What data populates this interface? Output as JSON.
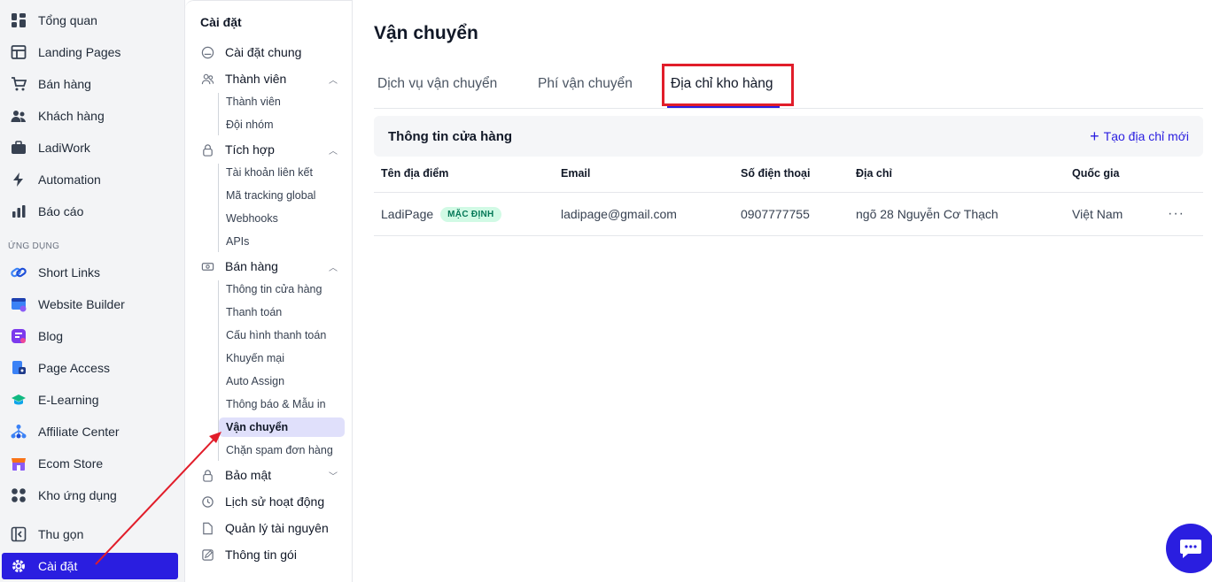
{
  "sidebar": {
    "items": [
      {
        "label": "Tổng quan",
        "icon": "dashboard-icon"
      },
      {
        "label": "Landing Pages",
        "icon": "layout-icon"
      },
      {
        "label": "Bán hàng",
        "icon": "cart-icon"
      },
      {
        "label": "Khách hàng",
        "icon": "users-icon"
      },
      {
        "label": "LadiWork",
        "icon": "briefcase-icon"
      },
      {
        "label": "Automation",
        "icon": "bolt-icon"
      },
      {
        "label": "Báo cáo",
        "icon": "bar-chart-icon"
      }
    ],
    "section_label": "ỨNG DỤNG",
    "apps": [
      {
        "label": "Short Links",
        "icon": "link-icon",
        "color": "#3b82f6"
      },
      {
        "label": "Website Builder",
        "icon": "website-icon",
        "color": "#6366f1"
      },
      {
        "label": "Blog",
        "icon": "blog-icon",
        "color": "#8b5cf6"
      },
      {
        "label": "Page Access",
        "icon": "page-access-icon",
        "color": "#2563eb"
      },
      {
        "label": "E-Learning",
        "icon": "elearning-icon",
        "color": "#10b981"
      },
      {
        "label": "Affiliate Center",
        "icon": "affiliate-icon",
        "color": "#3b82f6"
      },
      {
        "label": "Ecom Store",
        "icon": "store-icon",
        "color": "#f97316"
      },
      {
        "label": "Kho ứng dụng",
        "icon": "apps-icon",
        "color": "#374151"
      }
    ],
    "collapse_label": "Thu gọn",
    "settings_label": "Cài đặt"
  },
  "settings_nav": {
    "title": "Cài đặt",
    "general": "Cài đặt chung",
    "members": {
      "label": "Thành viên",
      "items": [
        "Thành viên",
        "Đội nhóm"
      ]
    },
    "integration": {
      "label": "Tích hợp",
      "items": [
        "Tài khoản liên kết",
        "Mã tracking global",
        "Webhooks",
        "APIs"
      ]
    },
    "sales": {
      "label": "Bán hàng",
      "items": [
        "Thông tin cửa hàng",
        "Thanh toán",
        "Cấu hình thanh toán",
        "Khuyến mại",
        "Auto Assign",
        "Thông báo & Mẫu in",
        "Vận chuyển",
        "Chặn spam đơn hàng"
      ]
    },
    "security": "Bảo mật",
    "activity": "Lịch sử hoạt động",
    "resources": "Quản lý tài nguyên",
    "plan": "Thông tin gói"
  },
  "main": {
    "title": "Vận chuyển",
    "tabs": [
      "Dịch vụ vận chuyển",
      "Phí vận chuyển",
      "Địa chỉ kho hàng"
    ],
    "active_tab": "Địa chỉ kho hàng",
    "card_title": "Thông tin cửa hàng",
    "new_button": "Tạo địa chỉ mới",
    "columns": [
      "Tên địa điểm",
      "Email",
      "Số điện thoại",
      "Địa chỉ",
      "Quốc gia"
    ],
    "rows": [
      {
        "name": "LadiPage",
        "badge": "MẶC ĐỊNH",
        "email": "ladipage@gmail.com",
        "phone": "0907777755",
        "address": "ngõ 28 Nguyễn Cơ Thạch",
        "country": "Việt Nam"
      }
    ],
    "more_glyph": "···"
  },
  "colors": {
    "accent": "#2a1ee0",
    "highlight": "#e11d2a",
    "badge_bg": "#d1fae5",
    "badge_text": "#047857"
  }
}
